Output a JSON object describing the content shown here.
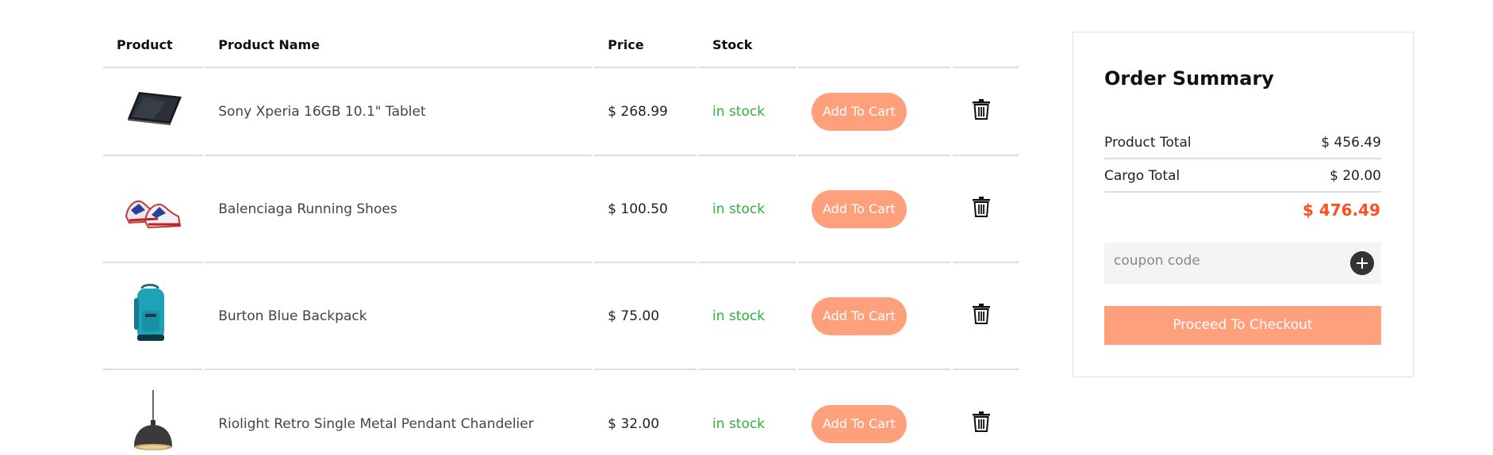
{
  "table": {
    "headers": {
      "product": "Product",
      "name": "Product Name",
      "price": "Price",
      "stock": "Stock"
    },
    "rows": [
      {
        "image": "tablet-image",
        "name": "Sony Xperia 16GB 10.1\" Tablet",
        "price": "$ 268.99",
        "stock": "in stock",
        "action": "Add To Cart",
        "delete_icon": "trash-icon"
      },
      {
        "image": "shoes-image",
        "name": "Balenciaga Running Shoes",
        "price": "$ 100.50",
        "stock": "in stock",
        "action": "Add To Cart",
        "delete_icon": "trash-icon"
      },
      {
        "image": "backpack-image",
        "name": "Burton Blue Backpack",
        "price": "$ 75.00",
        "stock": "in stock",
        "action": "Add To Cart",
        "delete_icon": "trash-icon"
      },
      {
        "image": "pendant-lamp-image",
        "name": "Riolight Retro Single Metal Pendant Chandelier",
        "price": "$ 32.00",
        "stock": "in stock",
        "action": "Add To Cart",
        "delete_icon": "trash-icon"
      }
    ]
  },
  "summary": {
    "title": "Order Summary",
    "product_total_label": "Product Total",
    "product_total_value": "$ 456.49",
    "cargo_total_label": "Cargo Total",
    "cargo_total_value": "$ 20.00",
    "grand_total": "$ 476.49",
    "coupon_placeholder": "coupon code",
    "coupon_icon": "plus-circle-icon",
    "checkout_label": "Proceed To Checkout"
  },
  "colors": {
    "accent_button": "#ffa07c",
    "in_stock": "#2eae3b",
    "total_highlight": "#ff4f1f"
  }
}
